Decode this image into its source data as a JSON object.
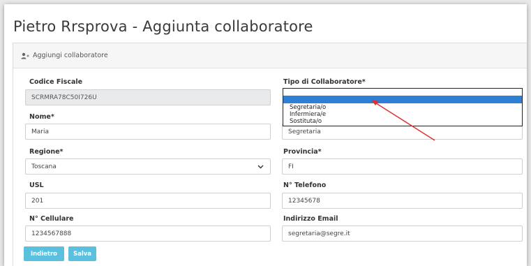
{
  "page": {
    "title": "Pietro Rrsprova - Aggiunta collaboratore"
  },
  "card": {
    "header_label": "Aggiungi collaboratore",
    "header_icon": "add-user-icon"
  },
  "form": {
    "codice_fiscale": {
      "label": "Codice Fiscale",
      "value": "SCRMRA78C50I726U"
    },
    "tipo_collaboratore": {
      "label": "Tipo di Collaboratore*",
      "selected": "",
      "options": [
        "Segretaria/o",
        "Infermiera/e",
        "Sostituta/o"
      ],
      "value_behind": "Segretaria"
    },
    "nome": {
      "label": "Nome*",
      "value": "Maria"
    },
    "regione": {
      "label": "Regione*",
      "value": "Toscana"
    },
    "provincia": {
      "label": "Provincia*",
      "value": "FI"
    },
    "usl": {
      "label": "USL",
      "value": "201"
    },
    "telefono": {
      "label": "N° Telefono",
      "value": "12345678"
    },
    "cellulare": {
      "label": "N° Cellulare",
      "value": "1234567888"
    },
    "email": {
      "label": "Indirizzo Email",
      "value": "segretaria@segre.it"
    }
  },
  "buttons": {
    "back": "Indietro",
    "save": "Salva"
  },
  "colors": {
    "button": "#5bc0de",
    "selection": "#2f7fd5",
    "annotation_arrow": "#e03030"
  }
}
